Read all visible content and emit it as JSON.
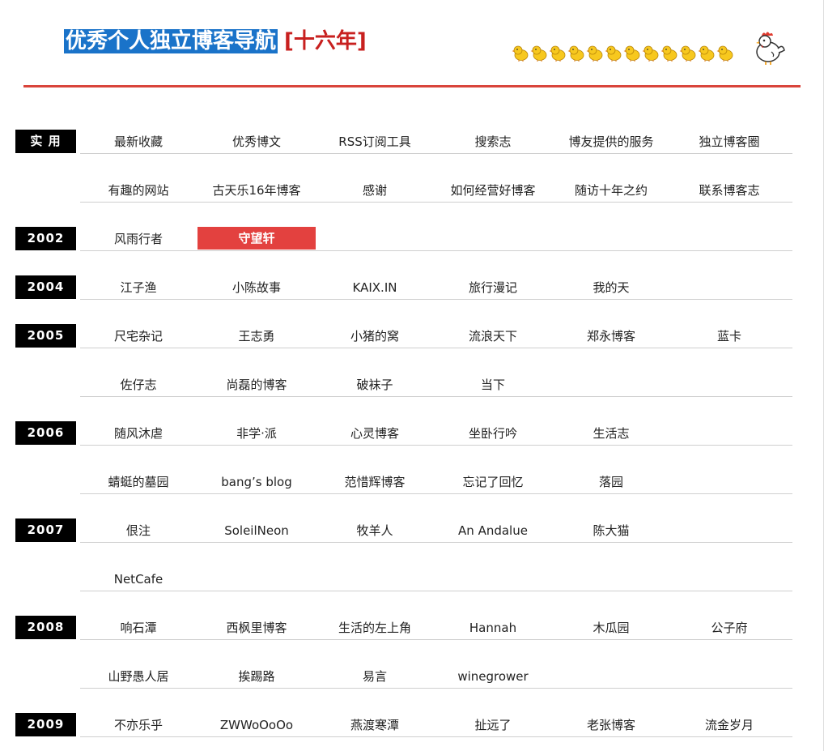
{
  "header": {
    "title": "优秀个人独立博客导航",
    "years_tag": "[十六年]",
    "chick_count": 12
  },
  "colors": {
    "title_highlight": "#1a73c9",
    "years_red": "#c8201f",
    "divider": "#d9443b",
    "label_bg": "#000000",
    "active_bg": "#e3413f"
  },
  "rows": [
    {
      "label": "实 用",
      "items": [
        "最新收藏",
        "优秀博文",
        "RSS订阅工具",
        "搜索志",
        "博友提供的服务",
        "独立博客圈"
      ]
    },
    {
      "label": "",
      "items": [
        "有趣的网站",
        "古天乐16年博客",
        "感谢",
        "如何经营好博客",
        "随访十年之约",
        "联系博客志"
      ]
    },
    {
      "label": "2002",
      "items": [
        "风雨行者",
        "守望轩"
      ],
      "active": 1
    },
    {
      "label": "2004",
      "items": [
        "江子渔",
        "小陈故事",
        "KAIX.IN",
        "旅行漫记",
        "我的天"
      ]
    },
    {
      "label": "2005",
      "items": [
        "尺宅杂记",
        "王志勇",
        "小猪的窝",
        "流浪天下",
        "郑永博客",
        "蓝卡"
      ]
    },
    {
      "label": "",
      "items": [
        "佐仔志",
        "尚磊的博客",
        "破袜子",
        "当下"
      ]
    },
    {
      "label": "2006",
      "items": [
        "随风沐虐",
        "非学·派",
        "心灵博客",
        "坐卧行吟",
        "生活志"
      ]
    },
    {
      "label": "",
      "items": [
        "蜻蜓的墓园",
        "bang’s blog",
        "范惜辉博客",
        "忘记了回忆",
        "落园"
      ]
    },
    {
      "label": "2007",
      "items": [
        "佷注",
        "SoleilNeon",
        "牧羊人",
        "An Andalue",
        "陈大猫"
      ]
    },
    {
      "label": "",
      "items": [
        "NetCafe"
      ]
    },
    {
      "label": "2008",
      "items": [
        "响石潭",
        "西枫里博客",
        "生活的左上角",
        "Hannah",
        "木瓜园",
        "公子府"
      ]
    },
    {
      "label": "",
      "items": [
        "山野愚人居",
        "挨踢路",
        "易言",
        "winegrower"
      ]
    },
    {
      "label": "2009",
      "items": [
        "不亦乐乎",
        "ZWWoOoOo",
        "燕渡寒潭",
        "扯远了",
        "老张博客",
        "流金岁月"
      ]
    }
  ]
}
